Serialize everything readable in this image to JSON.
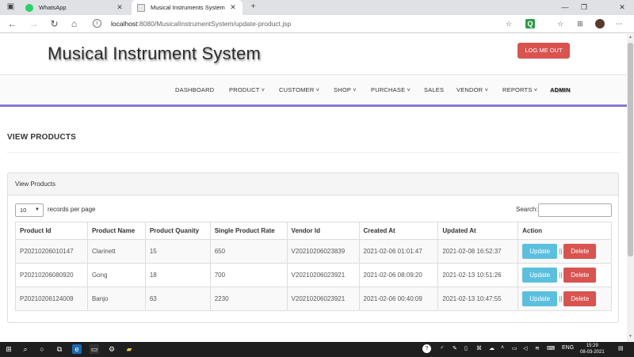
{
  "browser": {
    "tabs": [
      {
        "title": "WhatsApp",
        "icon": "whatsapp-icon",
        "active": false
      },
      {
        "title": "Musical Instruments System",
        "icon": "page-icon",
        "active": true
      }
    ],
    "url_host": "localhost",
    "url_path": ":8080/MusicalInstrumentSystem/update-product.jsp",
    "accent": "#8a78d4"
  },
  "header": {
    "title": "Musical Instrument System",
    "logout_label": "LOG ME OUT"
  },
  "nav": {
    "dashboard": "DASHBOARD",
    "product": "PRODUCT ˅",
    "customer": "CUSTOMER ˅",
    "shop": "SHOP ˅",
    "purchase": "PURCHASE ˅",
    "sales": "SALES",
    "vendor": "VENDOR ˅",
    "reports": "REPORTS ˅",
    "admin": "ADMIN"
  },
  "main": {
    "heading": "VIEW PRODUCTS",
    "panel_title": "View Products",
    "page_length": "10",
    "length_label": "records per page",
    "search_label": "Search:"
  },
  "table": {
    "headers": [
      "Product Id",
      "Product Name",
      "Product Quanity",
      "Single Product Rate",
      "Vendor Id",
      "Created At",
      "Updated At",
      "Action"
    ],
    "rows": [
      [
        "P20210206010147",
        "Clarinett",
        "15",
        "650",
        "V20210206023839",
        "2021-02-06 01:01:47",
        "2021-02-08 16:52:37"
      ],
      [
        "P20210206080920",
        "Gong",
        "18",
        "700",
        "V20210206023921",
        "2021-02-06 08:09:20",
        "2021-02-13 10:51:26"
      ],
      [
        "P20210206124009",
        "Banjo",
        "63",
        "2230",
        "V20210206023921",
        "2021-02-06 00:40:09",
        "2021-02-13 10:47:55"
      ]
    ],
    "update_label": "Update",
    "delete_label": "Delete",
    "separator": "||"
  },
  "taskbar": {
    "language": "ENG",
    "time": "15:29",
    "date": "08-03-2021"
  }
}
